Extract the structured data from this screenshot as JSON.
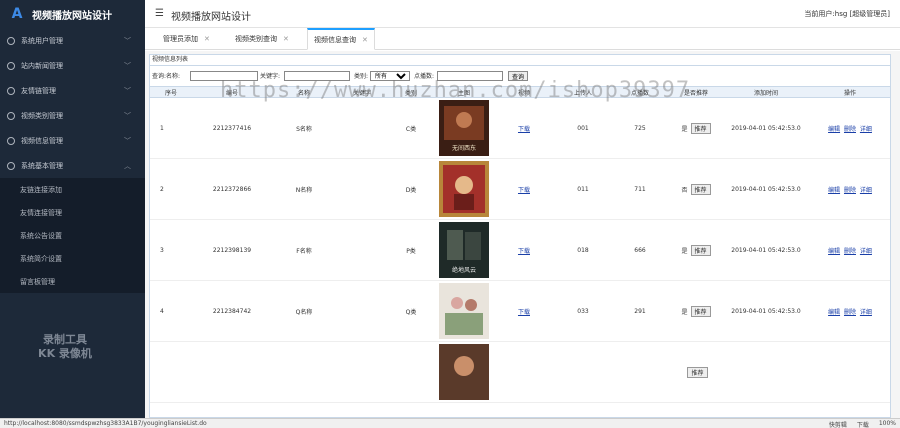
{
  "brand": {
    "logo": "A",
    "title": "视频播放网站设计"
  },
  "header": {
    "site_title": "视频播放网站设计",
    "user_info": "当前用户:hsg [超级管理员]",
    "menu_icon": "☰"
  },
  "sidebar": {
    "items": [
      {
        "label": "系统用户管理"
      },
      {
        "label": "站内新闻管理"
      },
      {
        "label": "友情链管理"
      },
      {
        "label": "视频类别管理"
      },
      {
        "label": "视频信息管理"
      },
      {
        "label": "系统基本管理"
      }
    ],
    "sub_items": [
      {
        "label": "友链连接添加"
      },
      {
        "label": "友情连接管理"
      },
      {
        "label": "系统公告设置"
      },
      {
        "label": "系统简介设置"
      },
      {
        "label": "留言板管理"
      }
    ],
    "watermark_line1": "录制工具",
    "watermark_line2": "KK 录像机"
  },
  "tabs": [
    {
      "label": "管理员添加"
    },
    {
      "label": "视频类别查询"
    },
    {
      "label": "视频信息查询"
    }
  ],
  "panel": {
    "title": "视频信息列表"
  },
  "search": {
    "name_label": "查询:名称:",
    "keyword_label": "关键字:",
    "category_label": "类别:",
    "category_value": "所有",
    "views_label": "点播数:",
    "button": "查询"
  },
  "table": {
    "headers": [
      "序号",
      "编号",
      "名称",
      "关键字",
      "类别",
      "主图",
      "视频",
      "上传人",
      "点播数",
      "是否推荐",
      "添加时间",
      "操作"
    ],
    "rows": [
      {
        "index": "1",
        "code": "2212377416",
        "name": "S名称",
        "keyword": "",
        "category": "C类",
        "video": "下载",
        "uploader": "001",
        "views": "725",
        "recommended": "是",
        "time": "2019-04-01 05:42:53.0"
      },
      {
        "index": "2",
        "code": "2212372866",
        "name": "N名称",
        "keyword": "",
        "category": "D类",
        "video": "下载",
        "uploader": "011",
        "views": "711",
        "recommended": "否",
        "time": "2019-04-01 05:42:53.0"
      },
      {
        "index": "3",
        "code": "2212398139",
        "name": "F名称",
        "keyword": "",
        "category": "P类",
        "video": "下载",
        "uploader": "018",
        "views": "666",
        "recommended": "是",
        "time": "2019-04-01 05:42:53.0"
      },
      {
        "index": "4",
        "code": "2212384742",
        "name": "Q名称",
        "keyword": "",
        "category": "Q类",
        "video": "下载",
        "uploader": "033",
        "views": "291",
        "recommended": "是",
        "time": "2019-04-01 05:42:53.0"
      }
    ],
    "recommend_button": "推荐",
    "op_edit": "编辑",
    "op_delete": "删除",
    "op_detail": "详细",
    "poster_caption_1": "无间西东",
    "poster_caption_3": "绝地风云"
  },
  "watermark": "https://www.huzhan.com/ishop39397",
  "statusbar": {
    "url": "http://localhost:8080/ssmdspwzhsg3833A1B7/yougingliansieList.do",
    "items": [
      "快剪辑",
      "下载",
      "100%"
    ]
  }
}
